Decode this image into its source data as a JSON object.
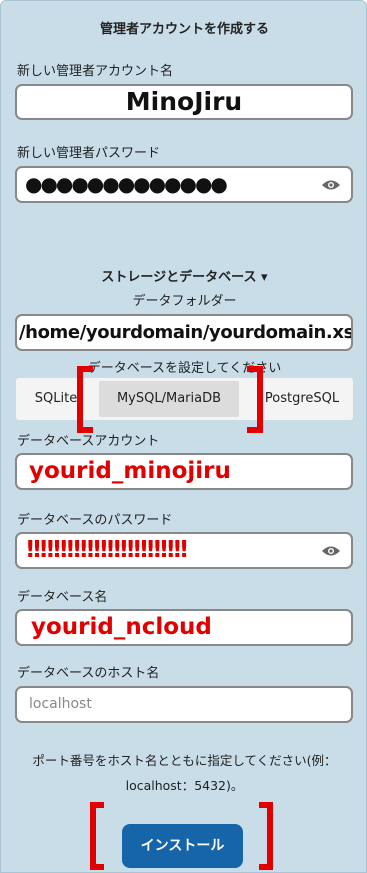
{
  "form": {
    "heading": "管理者アカウントを作成する",
    "admin_user_label": "新しい管理者アカウント名",
    "admin_user_value": "MinoJiru",
    "admin_pass_label": "新しい管理者パスワード",
    "admin_pass_value": "●●●●●●●●●●●●●",
    "storage_toggle": "ストレージとデータベース ▾",
    "data_folder_label": "データフォルダー",
    "data_folder_value": "/home/yourdomain/yourdomain.xsrv",
    "db_config_label": "データベースを設定してください",
    "db_tabs": [
      "SQLite",
      "MySQL/MariaDB",
      "PostgreSQL"
    ],
    "db_user_label": "データベースアカウント",
    "db_user_value": "yourid_minojiru",
    "db_pass_label": "データベースのパスワード",
    "db_pass_value": "!!!!!!!!!!!!!!!!!!!!!!!!",
    "db_name_label": "データベース名",
    "db_name_value": "yourid_ncloud",
    "db_host_label": "データベースのホスト名",
    "db_host_placeholder": "localhost",
    "port_hint_line1": "ポート番号をホスト名とともに指定してください(例：",
    "port_hint_line2": "localhost：5432)。",
    "install_button": "インストール"
  },
  "colors": {
    "panel_bg": "#c9dde9",
    "accent_button": "#1565a8",
    "annotation_red": "#e00000"
  },
  "icons": [
    "eye-icon"
  ]
}
